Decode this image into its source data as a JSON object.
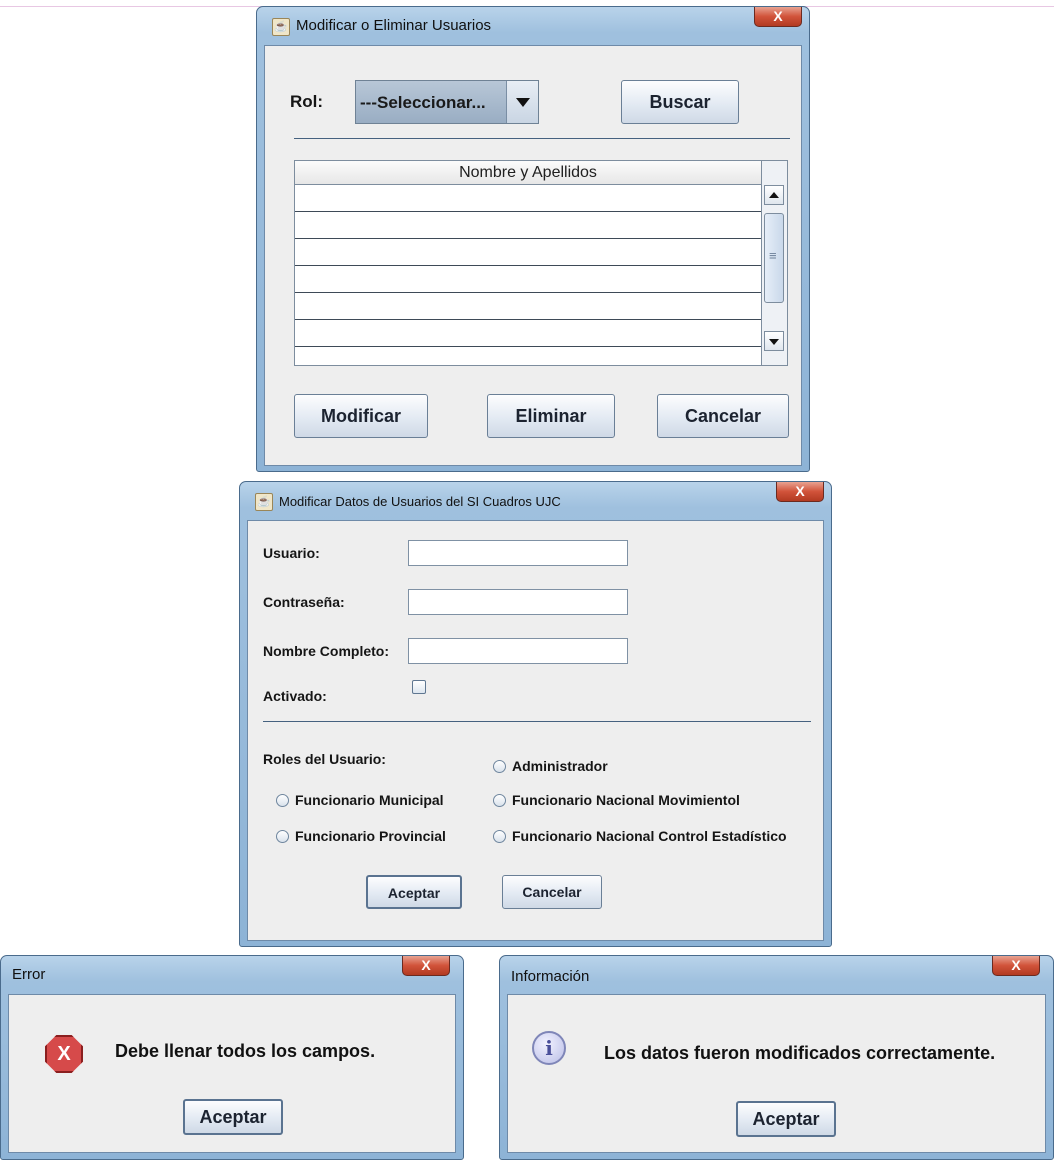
{
  "window1": {
    "title": "Modificar o Eliminar Usuarios",
    "rol_label": "Rol:",
    "combo_value": "---Seleccionar...",
    "buscar": "Buscar",
    "table_header": "Nombre y Apellidos",
    "modificar": "Modificar",
    "eliminar": "Eliminar",
    "cancelar": "Cancelar"
  },
  "window2": {
    "title": "Modificar Datos de Usuarios del SI Cuadros UJC",
    "usuario_label": "Usuario:",
    "contrasena_label": "Contraseña:",
    "nombre_label": "Nombre Completo:",
    "activado_label": "Activado:",
    "roles_label": "Roles del Usuario:",
    "roles": {
      "administrador": "Administrador",
      "func_municipal": "Funcionario Municipal",
      "func_nac_mov": "Funcionario Nacional  Movimientol",
      "func_provincial": "Funcionario Provincial",
      "func_nac_control": "Funcionario Nacional Control Estadístico"
    },
    "aceptar": "Aceptar",
    "cancelar": "Cancelar"
  },
  "error_dialog": {
    "title": "Error",
    "message": "Debe llenar todos los campos.",
    "button": "Aceptar"
  },
  "info_dialog": {
    "title": "Información",
    "message": "Los datos fueron modificados correctamente.",
    "button": "Aceptar"
  },
  "close_glyph": "X",
  "colors": {
    "titlebar": "#9fc0de",
    "client": "#eeeeee",
    "close": "#d1533a"
  }
}
